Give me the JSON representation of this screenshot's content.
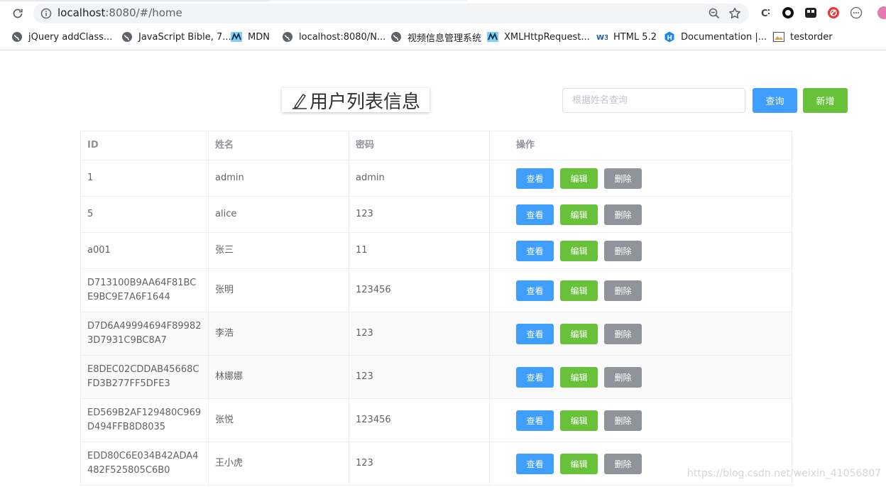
{
  "browser": {
    "url_host": "localhost",
    "url_rest": ":8080/#/home",
    "bookmarks": [
      {
        "label": "jQuery addClass..."
      },
      {
        "label": "JavaScript Bible, 7..."
      },
      {
        "label": "MDN"
      },
      {
        "label": "localhost:8080/N..."
      },
      {
        "label": "视频信息管理系统"
      },
      {
        "label": "XMLHttpRequest..."
      },
      {
        "label": "HTML 5.2"
      },
      {
        "label": "Documentation |..."
      },
      {
        "label": "testorder"
      }
    ]
  },
  "page": {
    "title": "用户列表信息",
    "search_placeholder": "根据姓名查询",
    "query_label": "查询",
    "add_label": "新增"
  },
  "table": {
    "headers": [
      "ID",
      "姓名",
      "密码",
      "操作"
    ],
    "rows": [
      {
        "id": "1",
        "name": "admin",
        "password": "admin"
      },
      {
        "id": "5",
        "name": "alice",
        "password": "123"
      },
      {
        "id": "a001",
        "name": "张三",
        "password": "11"
      },
      {
        "id": "D713100B9AA64F81BCE9BC9E7A6F1644",
        "name": "张明",
        "password": "123456"
      },
      {
        "id": "D7D6A49994694F899823D7931C9BC8A7",
        "name": "李浩",
        "password": "123"
      },
      {
        "id": "E8DEC02CDDAB45668CFD3B277FF5DFE3",
        "name": "林娜娜",
        "password": "123"
      },
      {
        "id": "ED569B2AF129480C969D494FFB8D8035",
        "name": "张悦",
        "password": "123456"
      },
      {
        "id": "EDD80C6E034B42ADA4482F525805C6B0",
        "name": "王小虎",
        "password": "123"
      }
    ],
    "actions": {
      "view": "查看",
      "edit": "编辑",
      "delete": "删除"
    }
  },
  "watermark": "https://blog.csdn.net/weixin_41056807",
  "colors": {
    "primary": "#409eff",
    "success": "#67c23a",
    "info": "#909399"
  }
}
